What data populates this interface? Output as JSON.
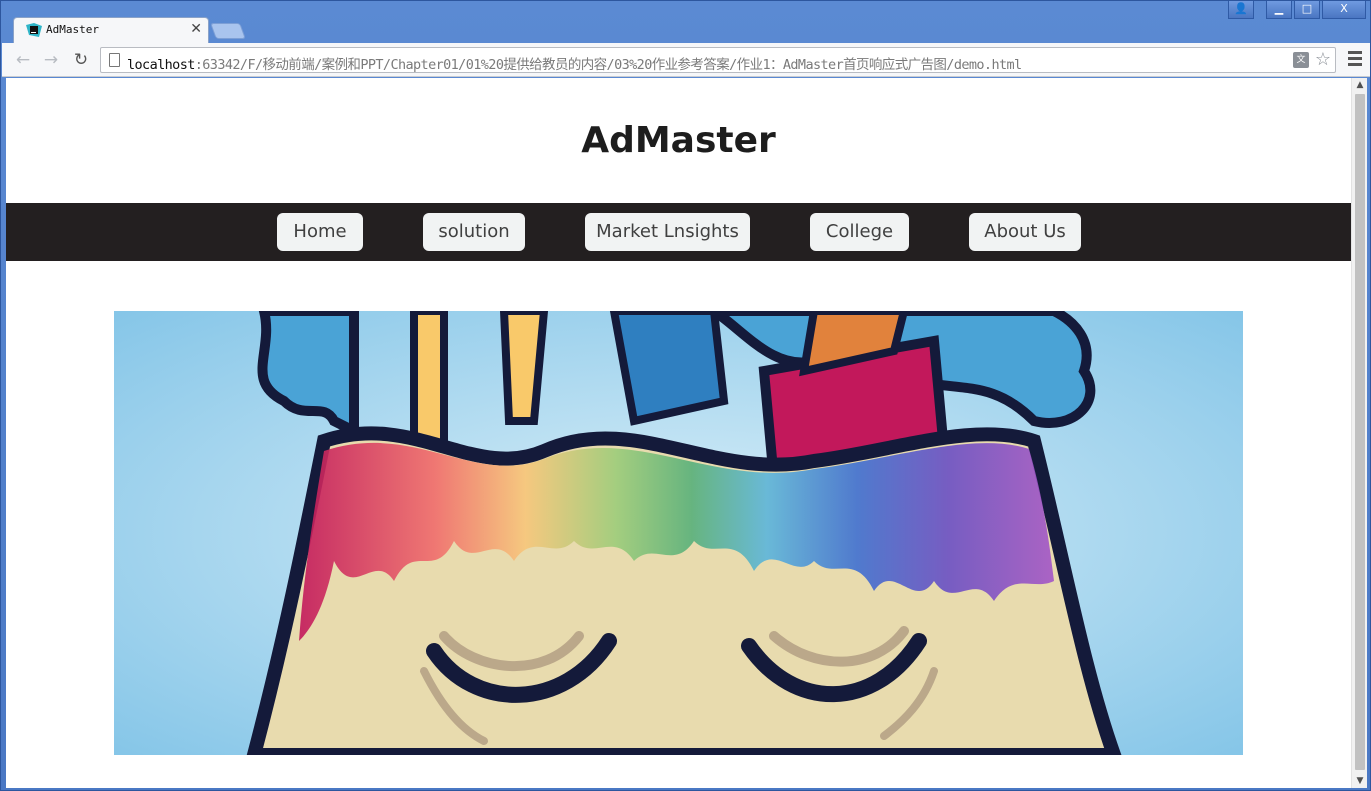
{
  "browser": {
    "tab_title": "AdMaster",
    "url_host": "localhost",
    "url_rest": ":63342/F/移动前端/案例和PPT/Chapter01/01%20提供给教员的内容/03%20作业参考答案/作业1：AdMaster首页响应式广告图/demo.html",
    "tab_close_glyph": "✕",
    "back_glyph": "←",
    "forward_glyph": "→",
    "reload_glyph": "↻",
    "star_glyph": "☆",
    "translate_glyph": "文",
    "window_buttons": {
      "user": "👤",
      "minimize": "▁",
      "maximize": "□",
      "close": "X"
    },
    "scroll_up_glyph": "▲",
    "scroll_down_glyph": "▼"
  },
  "page": {
    "title": "AdMaster",
    "nav": [
      {
        "label": "Home"
      },
      {
        "label": "solution"
      },
      {
        "label": "Market Lnsights"
      },
      {
        "label": "College"
      },
      {
        "label": "About Us"
      }
    ],
    "colors": {
      "nav_background": "#231f20",
      "nav_button": "#f1f3f3",
      "banner_sky": "#8fcbea",
      "banner_face": "#e8dbae"
    }
  }
}
